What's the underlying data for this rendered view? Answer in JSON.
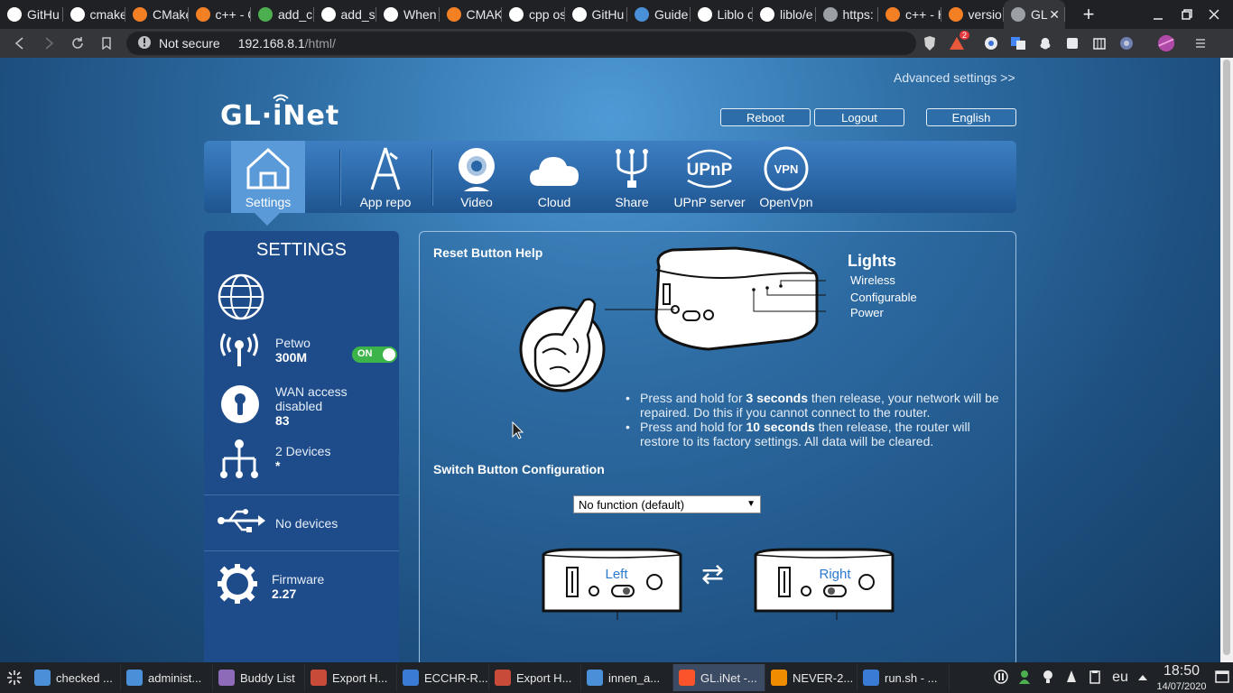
{
  "browser": {
    "tabs": [
      {
        "label": "GitHu",
        "icon": "github-icon",
        "color": "#ffffff"
      },
      {
        "label": "cmake",
        "icon": "google-icon",
        "color": "#ffffff"
      },
      {
        "label": "CMake",
        "icon": "stackoverflow-icon",
        "color": "#f48024"
      },
      {
        "label": "c++ - C",
        "icon": "stackoverflow-icon",
        "color": "#f48024"
      },
      {
        "label": "add_c",
        "icon": "cmake-icon",
        "color": "#4caf50"
      },
      {
        "label": "add_su",
        "icon": "google-icon",
        "color": "#ffffff"
      },
      {
        "label": "When",
        "icon": "github-icon",
        "color": "#ffffff"
      },
      {
        "label": "CMAK",
        "icon": "stackoverflow-icon",
        "color": "#f48024"
      },
      {
        "label": "cpp os",
        "icon": "google-icon",
        "color": "#ffffff"
      },
      {
        "label": "GitHu",
        "icon": "github-icon",
        "color": "#ffffff"
      },
      {
        "label": "Guide",
        "icon": "guide-icon",
        "color": "#4a90d9"
      },
      {
        "label": "Liblo c",
        "icon": "google-icon",
        "color": "#ffffff"
      },
      {
        "label": "liblo/e",
        "icon": "github-icon",
        "color": "#ffffff"
      },
      {
        "label": "https:",
        "icon": "globe-icon",
        "color": "#9aa0a6"
      },
      {
        "label": "c++ - H",
        "icon": "stackoverflow-icon",
        "color": "#f48024"
      },
      {
        "label": "versio",
        "icon": "stackoverflow-icon",
        "color": "#f48024"
      },
      {
        "label": "GL",
        "icon": "globe-icon",
        "color": "#9aa0a6"
      }
    ],
    "new_tab": "+",
    "omnibox": {
      "security": "Not secure",
      "host": "192.168.8.1",
      "path": "/html/"
    },
    "ext_badge": "2"
  },
  "page": {
    "advanced_link": "Advanced settings >>",
    "logo": "GL·iNet",
    "buttons": {
      "reboot": "Reboot",
      "logout": "Logout",
      "language": "English"
    },
    "nav": [
      {
        "label": "Settings"
      },
      {
        "label": "App repo"
      },
      {
        "label": "Video"
      },
      {
        "label": "Cloud"
      },
      {
        "label": "Share"
      },
      {
        "label": "UPnP server"
      },
      {
        "label": "OpenVpn"
      }
    ],
    "nav_icon_text": {
      "upnp": "UPnP",
      "vpn": "VPN"
    },
    "sidebar": {
      "title": "SETTINGS",
      "wifi": {
        "name": "Petwo",
        "speed": "300M",
        "toggle": "ON"
      },
      "wan": {
        "line1": "WAN access",
        "line2": "disabled",
        "value": "83"
      },
      "devices": {
        "label": "2 Devices",
        "value": "*"
      },
      "usb": {
        "label": "No devices"
      },
      "firmware": {
        "label": "Firmware",
        "version": "2.27"
      }
    },
    "reset": {
      "title": "Reset Button Help",
      "lights_title": "Lights",
      "lights": [
        "Wireless",
        "Configurable",
        "Power"
      ],
      "bullet1": {
        "pre": "Press and hold for ",
        "bold": "3 seconds",
        "post": " then release, your network will be repaired. Do this if you cannot connect to the router."
      },
      "bullet2": {
        "pre": "Press and hold for ",
        "bold": "10 seconds",
        "post": " then release, the router will restore to its factory settings. All data will be cleared."
      }
    },
    "switch": {
      "title": "Switch Button Configuration",
      "selected": "No function (default)",
      "left_label": "Left",
      "right_label": "Right",
      "swap_symbol": "⇄"
    }
  },
  "taskbar": {
    "items": [
      {
        "label": "checked ...",
        "color": "#4a90d9"
      },
      {
        "label": "administ...",
        "color": "#4a90d9"
      },
      {
        "label": "Buddy List",
        "color": "#8e6bb8"
      },
      {
        "label": "Export H...",
        "color": "#c84b3a"
      },
      {
        "label": "ECCHR-R...",
        "color": "#3a7bd5"
      },
      {
        "label": "Export H...",
        "color": "#c84b3a"
      },
      {
        "label": "innen_a...",
        "color": "#4a90d9"
      },
      {
        "label": "GL.iNet -...",
        "color": "#fb542b"
      },
      {
        "label": "NEVER-2...",
        "color": "#f08c00"
      },
      {
        "label": "run.sh - ...",
        "color": "#3a7bd5"
      }
    ],
    "keyboard": "eu",
    "time": "18:50",
    "date": "14/07/2020"
  }
}
